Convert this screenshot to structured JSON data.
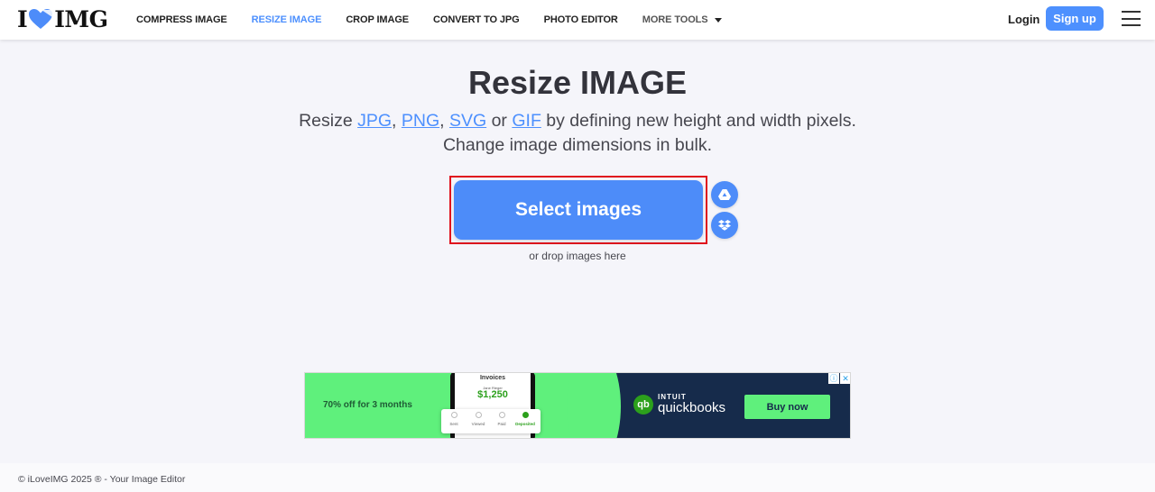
{
  "header": {
    "logo": {
      "left": "I",
      "right": "IMG"
    },
    "nav": [
      {
        "label": "COMPRESS IMAGE",
        "active": false
      },
      {
        "label": "RESIZE IMAGE",
        "active": true
      },
      {
        "label": "CROP IMAGE",
        "active": false
      },
      {
        "label": "CONVERT TO JPG",
        "active": false
      },
      {
        "label": "PHOTO EDITOR",
        "active": false
      },
      {
        "label": "MORE TOOLS",
        "active": false
      }
    ],
    "login_label": "Login",
    "signup_label": "Sign up"
  },
  "main": {
    "title": "Resize IMAGE",
    "subtitle": {
      "prefix": "Resize ",
      "formats": [
        "JPG",
        "PNG",
        "SVG",
        "GIF"
      ],
      "sep1": ", ",
      "sep2": ", ",
      "sep3": " or ",
      "suffix": " by defining new height and width pixels.",
      "line2": "Change image dimensions in bulk."
    },
    "select_button_label": "Select images",
    "drop_text": "or drop images here",
    "cloud_icons": [
      "google-drive-icon",
      "dropbox-icon"
    ]
  },
  "ad": {
    "offer": "70% off for 3 months",
    "invoice_title": "Invoices",
    "invoice_name": "Jane Rieger",
    "invoice_amount": "$1,250",
    "steps": [
      "Sent",
      "Viewed",
      "Paid",
      "Deposited"
    ],
    "brand_top": "INTUIT",
    "brand": "quickbooks",
    "brand_logo": "qb",
    "cta": "Buy now",
    "info_glyph": "ⓘ",
    "close_glyph": "✕"
  },
  "colors": {
    "accent": "#4d90fe",
    "highlight_border": "#e0111d",
    "ad_green": "#5ff07c",
    "ad_navy": "#162b4b"
  },
  "footer": {
    "text": "© iLoveIMG 2025 ® - Your Image Editor"
  }
}
